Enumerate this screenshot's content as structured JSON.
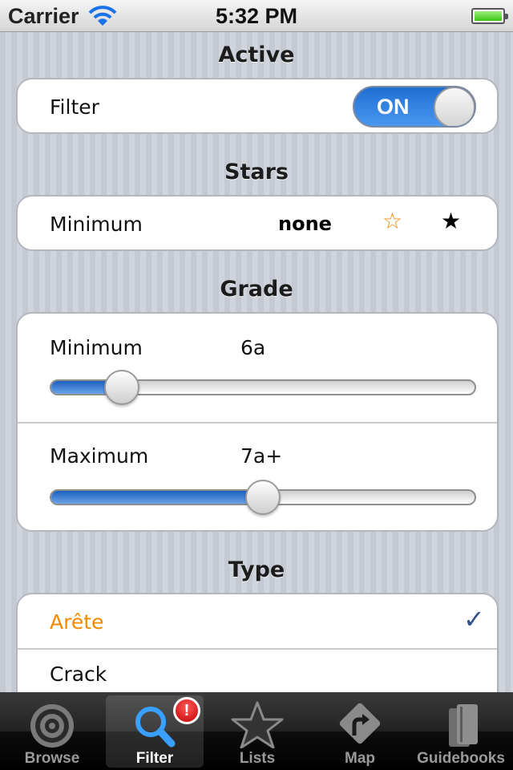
{
  "status_bar": {
    "carrier": "Carrier",
    "time": "5:32 PM"
  },
  "active_section": {
    "title": "Active",
    "filter_label": "Filter",
    "switch_label": "ON",
    "switch_on": true
  },
  "stars_section": {
    "title": "Stars",
    "label": "Minimum",
    "value": "none",
    "outline_star": "☆",
    "filled_star": "★"
  },
  "grade_section": {
    "title": "Grade",
    "minimum": {
      "label": "Minimum",
      "value": "6a",
      "slider_fraction": 0.17
    },
    "maximum": {
      "label": "Maximum",
      "value": "7a+",
      "slider_fraction": 0.5
    }
  },
  "type_section": {
    "title": "Type",
    "items": [
      {
        "label": "Arête",
        "selected": true
      },
      {
        "label": "Crack",
        "selected": false
      }
    ],
    "checkmark": "✓"
  },
  "tab_bar": {
    "tabs": [
      {
        "label": "Browse",
        "icon": "target-icon",
        "active": false
      },
      {
        "label": "Filter",
        "icon": "magnifier-icon",
        "active": true,
        "badge": "!"
      },
      {
        "label": "Lists",
        "icon": "star-icon",
        "active": false
      },
      {
        "label": "Map",
        "icon": "direction-sign-icon",
        "active": false
      },
      {
        "label": "Guidebooks",
        "icon": "books-icon",
        "active": false
      }
    ]
  },
  "colors": {
    "accent_orange": "#f08a00",
    "switch_blue": "#1f6fd2",
    "checkmark_blue": "#35538a",
    "badge_red": "#d00000"
  }
}
